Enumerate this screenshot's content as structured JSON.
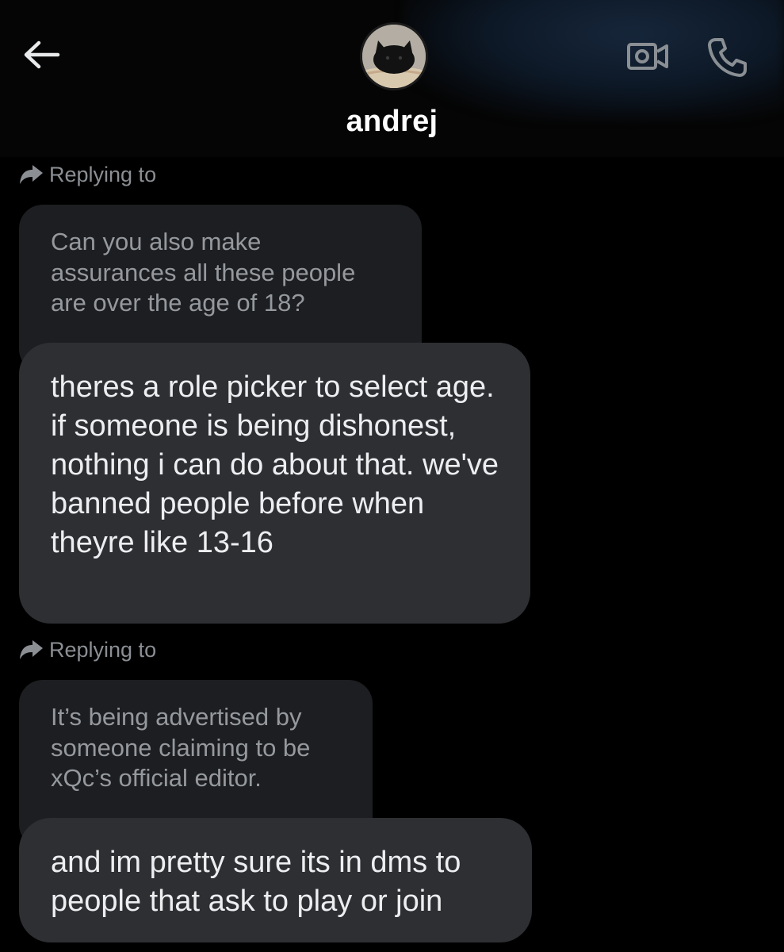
{
  "header": {
    "contact_name": "andrej",
    "back_icon": "arrow-left-icon",
    "video_icon": "video-camera-icon",
    "call_icon": "phone-icon",
    "avatar": "cat-avatar",
    "accent_color": "#16263a"
  },
  "messages": [
    {
      "reply_label": "Replying to",
      "quoted_text": "Can you also make assurances all these people are over the age of 18?",
      "text": "theres a role picker to select age. if someone is being dishonest, nothing i can do about that. we've banned people before when theyre like 13-16"
    },
    {
      "reply_label": "Replying to",
      "quoted_text": "It’s being advertised by someone claiming to be xQc’s official editor.",
      "text": "and im pretty sure its in dms to people that ask to play or join"
    }
  ],
  "colors": {
    "background": "#000000",
    "bubble": "#2e2f33",
    "quoted_bubble": "#1d1e21",
    "muted_text": "#8b8f94"
  }
}
